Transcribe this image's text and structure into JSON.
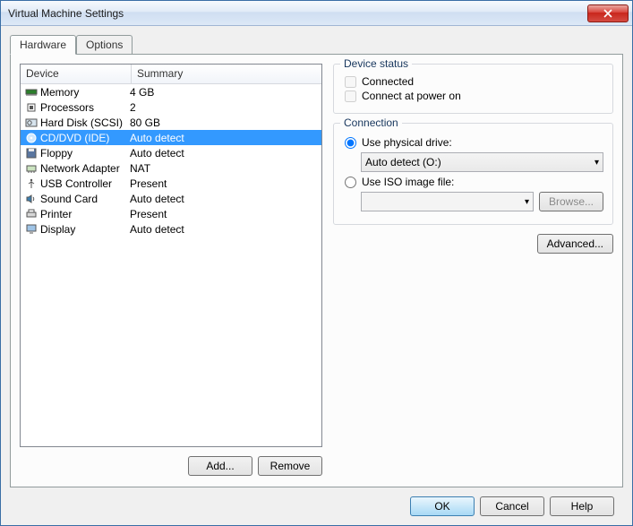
{
  "window": {
    "title": "Virtual Machine Settings"
  },
  "tabs": {
    "hardware": "Hardware",
    "options": "Options"
  },
  "table": {
    "h_device": "Device",
    "h_summary": "Summary",
    "rows": [
      {
        "icon": "memory",
        "device": "Memory",
        "summary": "4 GB"
      },
      {
        "icon": "cpu",
        "device": "Processors",
        "summary": "2"
      },
      {
        "icon": "hdd",
        "device": "Hard Disk (SCSI)",
        "summary": "80 GB"
      },
      {
        "icon": "cd",
        "device": "CD/DVD (IDE)",
        "summary": "Auto detect"
      },
      {
        "icon": "floppy",
        "device": "Floppy",
        "summary": "Auto detect"
      },
      {
        "icon": "nic",
        "device": "Network Adapter",
        "summary": "NAT"
      },
      {
        "icon": "usb",
        "device": "USB Controller",
        "summary": "Present"
      },
      {
        "icon": "sound",
        "device": "Sound Card",
        "summary": "Auto detect"
      },
      {
        "icon": "printer",
        "device": "Printer",
        "summary": "Present"
      },
      {
        "icon": "display",
        "device": "Display",
        "summary": "Auto detect"
      }
    ]
  },
  "leftButtons": {
    "add": "Add...",
    "remove": "Remove"
  },
  "status": {
    "legend": "Device status",
    "connected": "Connected",
    "poweron": "Connect at power on"
  },
  "connection": {
    "legend": "Connection",
    "usePhysical": "Use physical drive:",
    "physicalValue": "Auto detect (O:)",
    "useIso": "Use ISO image file:",
    "isoValue": "",
    "browse": "Browse..."
  },
  "advanced": "Advanced...",
  "footer": {
    "ok": "OK",
    "cancel": "Cancel",
    "help": "Help"
  }
}
